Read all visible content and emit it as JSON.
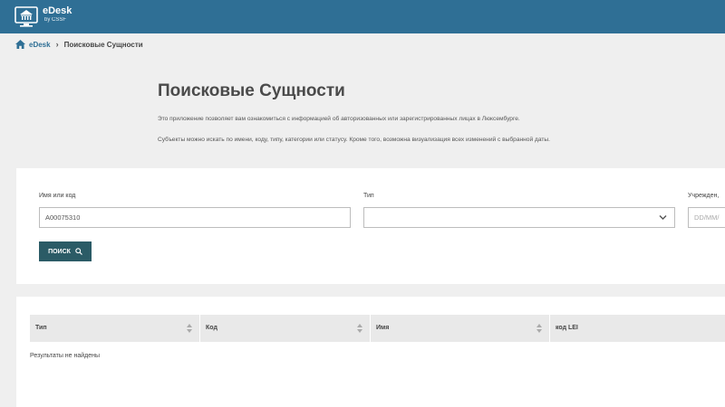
{
  "header": {
    "app_title": "eDesk",
    "app_subtitle": "by CSSF",
    "brand_color": "#2f6f95"
  },
  "breadcrumb": {
    "home_label": "eDesk",
    "current": "Поисковые Сущности"
  },
  "page": {
    "title": "Поисковые Сущности",
    "description_1": "Это приложение позволяет вам ознакомиться с информацией об авторизованных или зарегистрированных лицах в Люксембурге.",
    "description_2": "Субъекты можно искать по имени, коду, типу, категории или статусу. Кроме того, возможна визуализация всех изменений с выбранной даты."
  },
  "search": {
    "name_label": "Имя или код",
    "name_value": "A00075310",
    "type_label": "Тип",
    "type_value": "",
    "date_label": "Учрежден,",
    "date_placeholder": "DD/MM/",
    "button_label": "ПОИСК",
    "button_color": "#2b5b66"
  },
  "results": {
    "columns": [
      "Тип",
      "Код",
      "Имя",
      "код LEI"
    ],
    "empty_message": "Результаты не найдены"
  }
}
